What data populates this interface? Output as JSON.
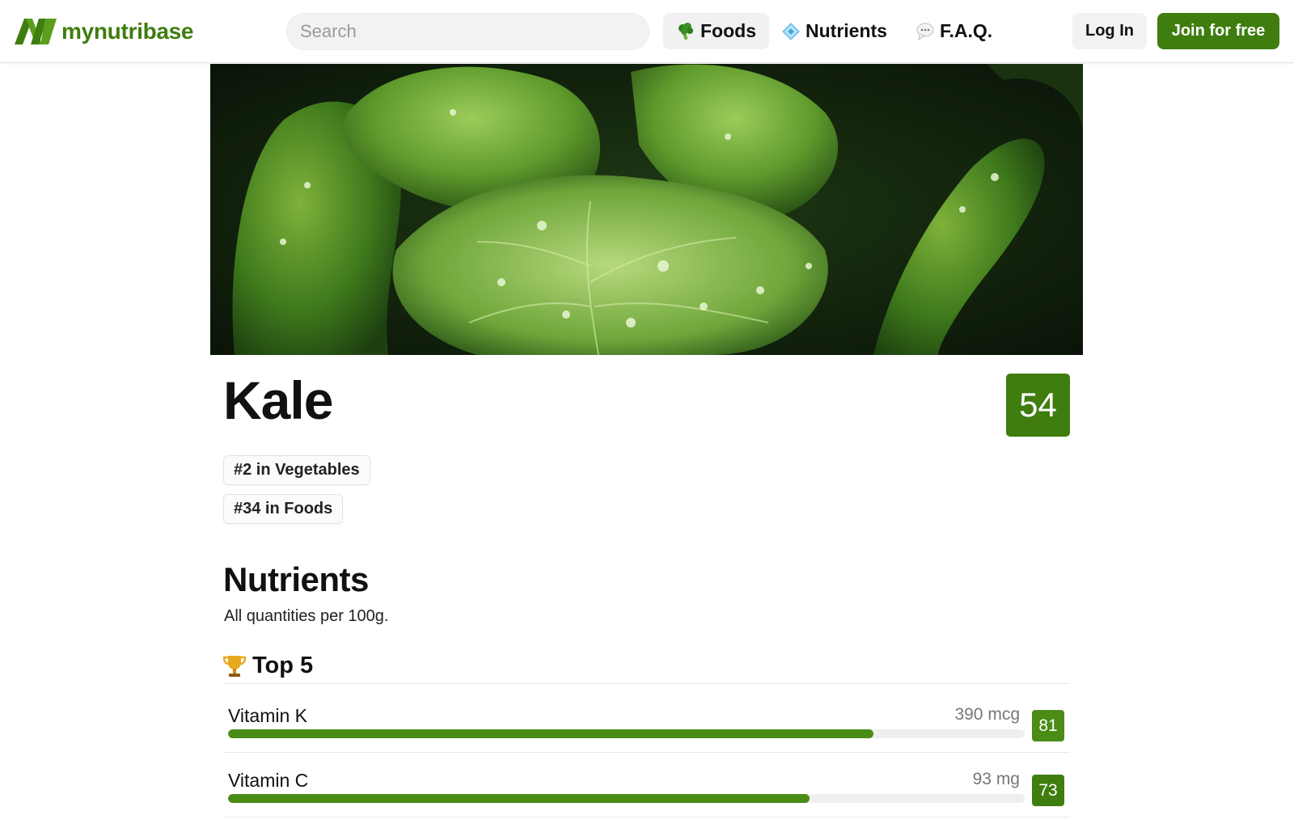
{
  "brand": {
    "name_prefix": "my",
    "name_rest": "nutribase",
    "color": "#3f7d0f"
  },
  "search": {
    "placeholder": "Search",
    "value": ""
  },
  "nav": {
    "items": [
      {
        "label": "Foods",
        "icon": "broccoli-icon",
        "active": true
      },
      {
        "label": "Nutrients",
        "icon": "diamond-icon",
        "active": false
      },
      {
        "label": "F.A.Q.",
        "icon": "speech-bubble-icon",
        "active": false
      }
    ]
  },
  "auth": {
    "login_label": "Log In",
    "join_label": "Join for free"
  },
  "hero": {
    "icon": "kale-leaves-photo"
  },
  "food": {
    "title": "Kale",
    "score": "54",
    "score_color": "#3f7d0f",
    "ranks": [
      "#2 in Vegetables",
      "#34 in Foods"
    ]
  },
  "nutrients": {
    "title": "Nutrients",
    "subtitle": "All quantities per 100g.",
    "top_title": "Top 5",
    "top_icon": "trophy-icon",
    "items": [
      {
        "name": "Vitamin K",
        "amount": "390 mcg",
        "score": "81",
        "fill_fraction": 0.81,
        "score_color": "#4a8c16"
      },
      {
        "name": "Vitamin C",
        "amount": "93 mg",
        "score": "73",
        "fill_fraction": 0.73,
        "score_color": "#3f7d0f"
      }
    ]
  }
}
